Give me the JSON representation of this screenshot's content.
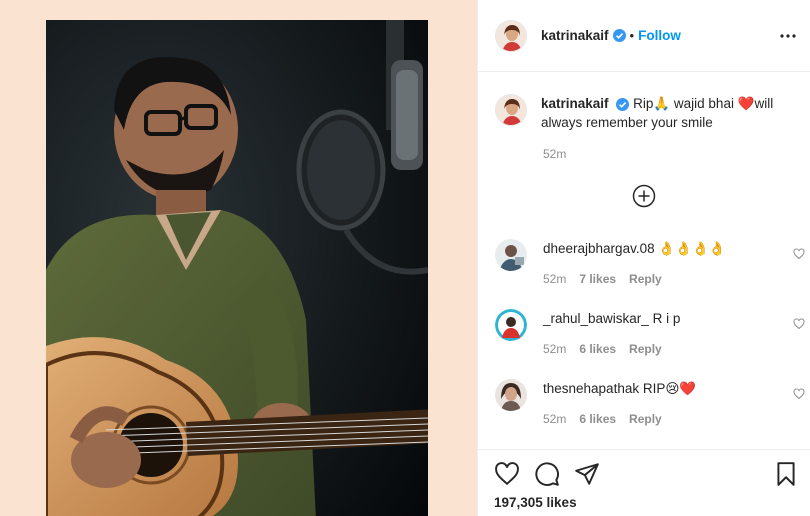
{
  "post": {
    "likes_text": "197,305 likes"
  },
  "header": {
    "username": "katrinakaif",
    "separator": "•",
    "follow_label": "Follow"
  },
  "caption": {
    "username": "katrinakaif",
    "text_part1": "Rip",
    "text_part2": " wajid bhai ",
    "text_part3": "will always remember your smile",
    "time": "52m"
  },
  "comments": [
    {
      "username": "dheerajbhargav.08",
      "text": "👌👌👌👌",
      "time": "52m",
      "likes": "7 likes",
      "reply": "Reply"
    },
    {
      "username": "_rahul_bawiskar_",
      "text": "R i p",
      "time": "52m",
      "likes": "6 likes",
      "reply": "Reply"
    },
    {
      "username": "thesnehapathak",
      "text": "RIP😢❤️",
      "time": "52m",
      "likes": "6 likes",
      "reply": "Reply"
    }
  ],
  "icons": {
    "verified": "verified-badge-icon",
    "more": "more-options-icon",
    "load_more": "plus-circle-icon",
    "like": "heart-icon",
    "comment": "comment-bubble-icon",
    "share": "paper-plane-icon",
    "save": "bookmark-icon"
  },
  "colors": {
    "accent": "#0095f6",
    "background_left": "#fbe3d1",
    "text_primary": "#262626",
    "text_secondary": "#8e8e8e",
    "heart": "#ed4956"
  }
}
